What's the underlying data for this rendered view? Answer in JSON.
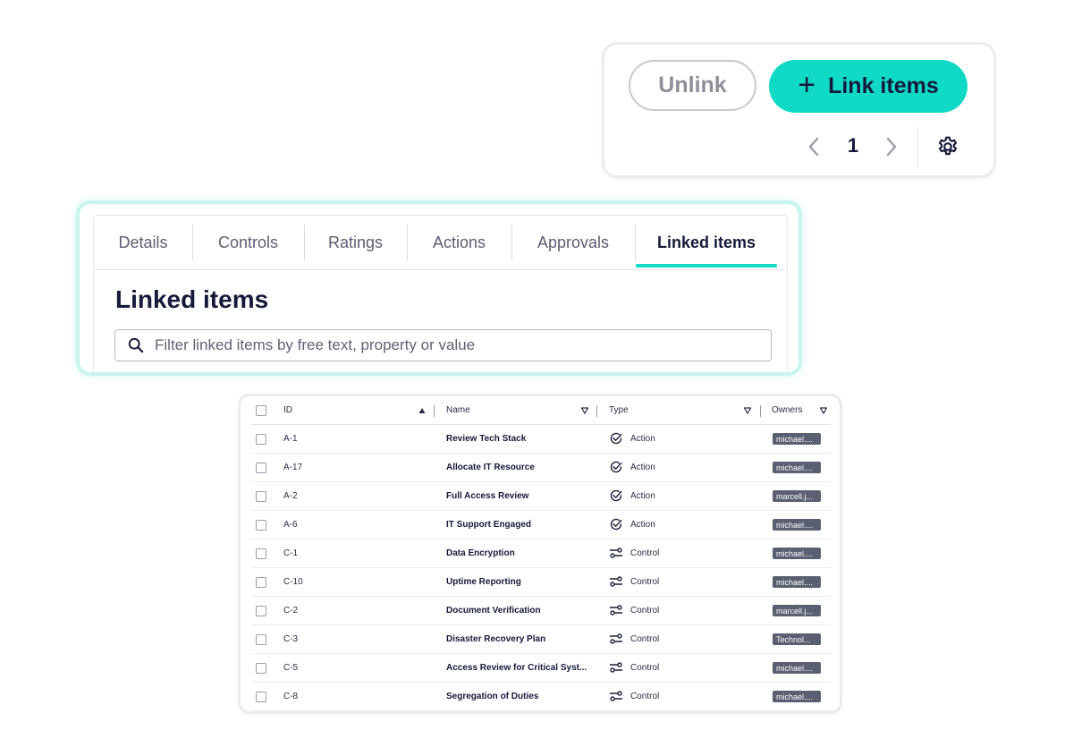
{
  "actions": {
    "unlink_label": "Unlink",
    "link_label": "Link items",
    "page_number": "1"
  },
  "tabs": [
    {
      "label": "Details"
    },
    {
      "label": "Controls"
    },
    {
      "label": "Ratings"
    },
    {
      "label": "Actions"
    },
    {
      "label": "Approvals"
    },
    {
      "label": "Linked items",
      "active": true
    }
  ],
  "section": {
    "title": "Linked items",
    "filter_placeholder": "Filter linked items by free text, property or value"
  },
  "table": {
    "columns": {
      "id": "ID",
      "name": "Name",
      "type": "Type",
      "owners": "Owners"
    },
    "rows": [
      {
        "id": "A-1",
        "name": "Review Tech Stack",
        "type": "Action",
        "owner": "michael...."
      },
      {
        "id": "A-17",
        "name": "Allocate IT Resource",
        "type": "Action",
        "owner": "michael...."
      },
      {
        "id": "A-2",
        "name": "Full Access Review",
        "type": "Action",
        "owner": "marcell.j..."
      },
      {
        "id": "A-6",
        "name": "IT Support Engaged",
        "type": "Action",
        "owner": "michael...."
      },
      {
        "id": "C-1",
        "name": "Data Encryption",
        "type": "Control",
        "owner": "michael...."
      },
      {
        "id": "C-10",
        "name": "Uptime Reporting",
        "type": "Control",
        "owner": "michael...."
      },
      {
        "id": "C-2",
        "name": "Document Verification",
        "type": "Control",
        "owner": "marcell.j..."
      },
      {
        "id": "C-3",
        "name": "Disaster Recovery Plan",
        "type": "Control",
        "owner": "Technol..."
      },
      {
        "id": "C-5",
        "name": "Access Review for Critical Syst...",
        "type": "Control",
        "owner": "michael...."
      },
      {
        "id": "C-8",
        "name": "Segregation of Duties",
        "type": "Control",
        "owner": "michael...."
      }
    ]
  },
  "colors": {
    "accent": "#10d9c6",
    "text_dark": "#151a3a",
    "owner_badge": "#5a6072"
  }
}
